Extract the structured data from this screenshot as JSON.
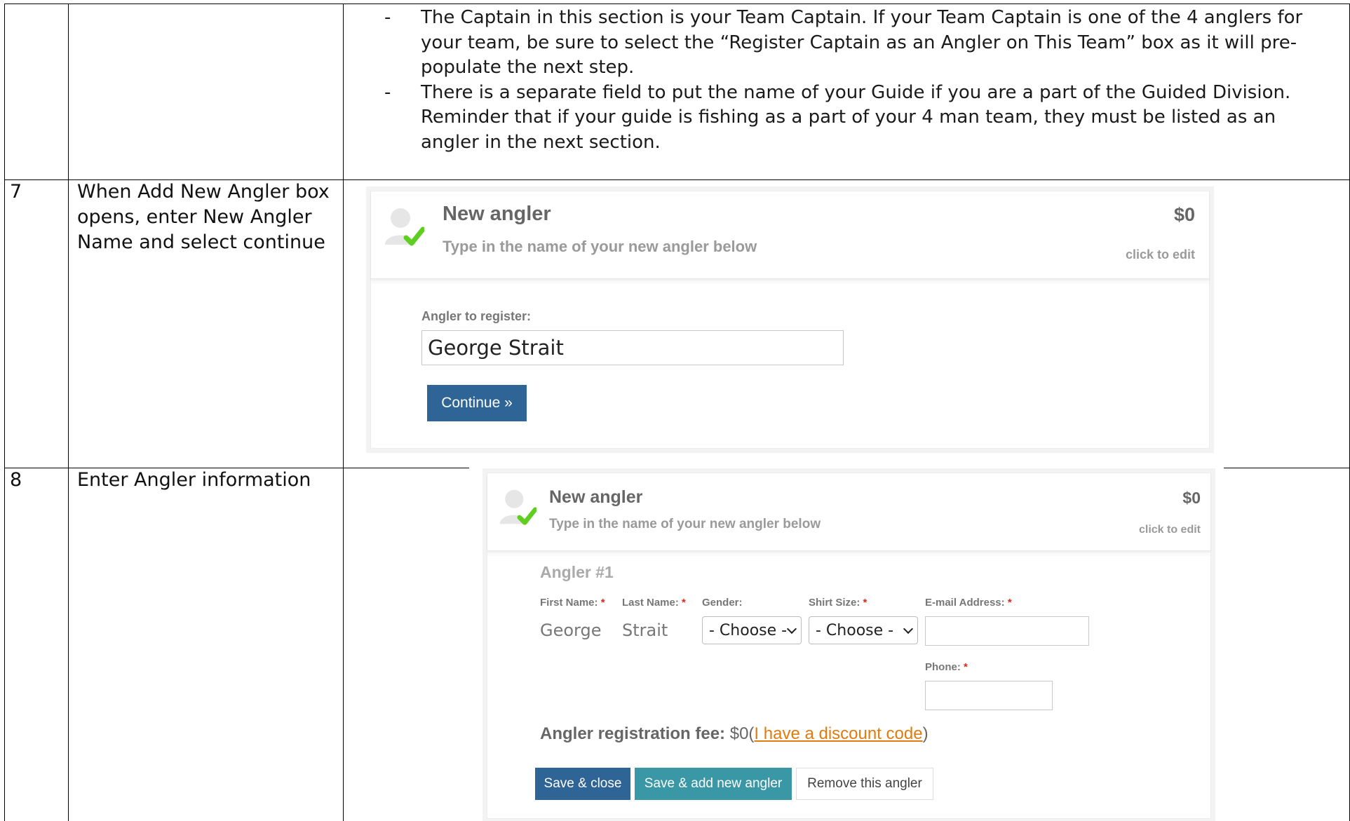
{
  "row_top": {
    "bullets": [
      "The Captain in this section is your Team Captain. If your Team Captain is one of the 4 anglers for your team, be sure to select the “Register Captain as an Angler on This Team” box as it will pre-populate the next step.",
      "There is a separate field to put the name of your Guide if you are a part of the Guided Division. Reminder that if your guide is fishing as a part of your 4 man team, they must be listed as an angler in the next section."
    ],
    "dash": "-"
  },
  "row7": {
    "number": "7",
    "description": "When Add New Angler box opens, enter New Angler Name and select continue",
    "panel": {
      "title": "New angler",
      "subtitle": "Type in the name of your new angler below",
      "price": "$0",
      "edit": "click to edit",
      "field_label": "Angler to register:",
      "field_value": "George Strait",
      "continue": "Continue »"
    }
  },
  "row8": {
    "number": "8",
    "description": "Enter Angler information",
    "panel": {
      "title": "New angler",
      "subtitle": "Type in the name of your new angler below",
      "price": "$0",
      "edit": "click to edit",
      "section": "Angler #1",
      "first_name_label": "First Name:",
      "last_name_label": "Last Name:",
      "gender_label": "Gender:",
      "shirt_label": "Shirt Size:",
      "email_label": "E-mail Address:",
      "phone_label": "Phone:",
      "required_mark": "*",
      "first_name": "George",
      "last_name": "Strait",
      "gender_select": "- Choose -",
      "shirt_select": "- Choose -",
      "email": "",
      "phone": "",
      "fee_label": "Angler registration fee:",
      "fee_value": "$0",
      "fee_paren_open": "(",
      "discount_link": "I have a discount code",
      "fee_paren_close": ")",
      "save_close": "Save & close",
      "save_add": "Save & add new angler",
      "remove": "Remove this angler"
    }
  },
  "colors": {
    "primary_button": "#2e6496",
    "teal_button": "#3a98a6",
    "link": "#e07b10",
    "check": "#5fcf1f",
    "required": "#d9291c"
  }
}
